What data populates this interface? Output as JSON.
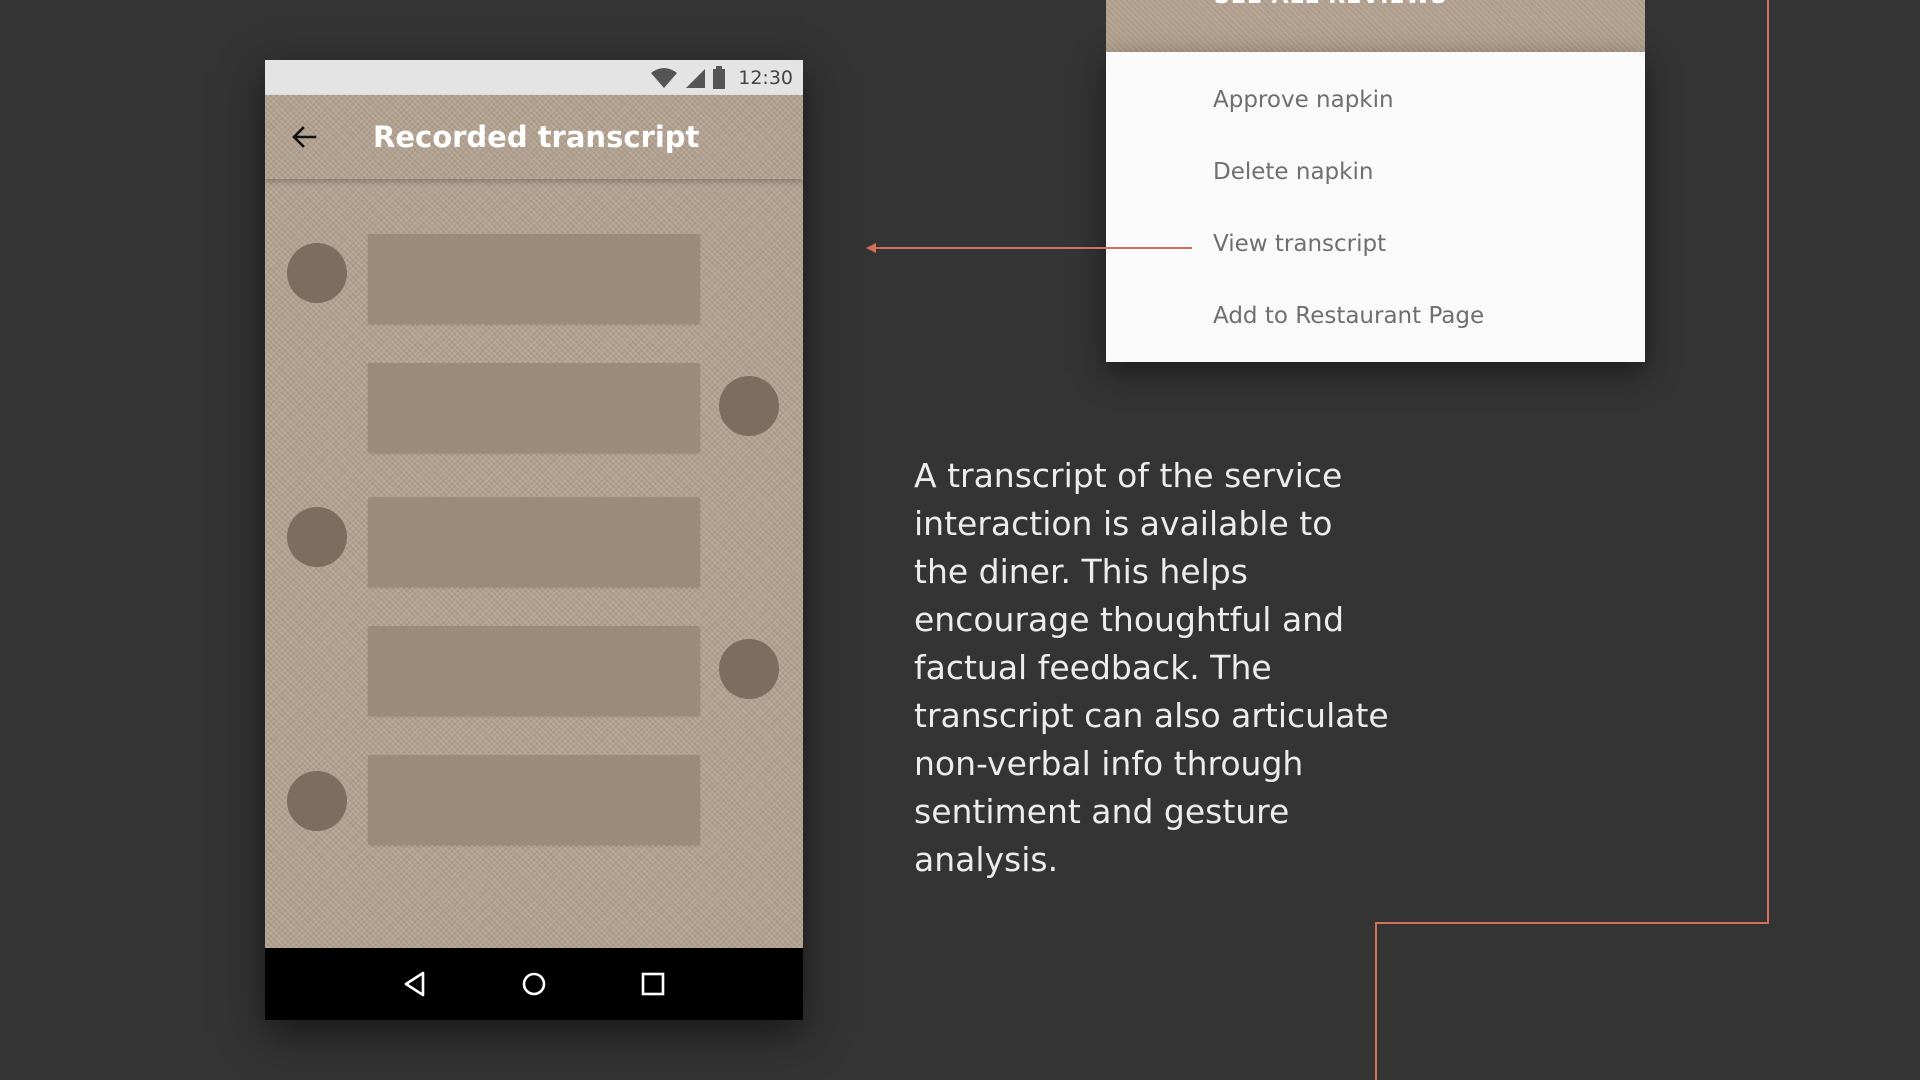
{
  "phone": {
    "status_bar": {
      "time": "12:30",
      "icons": [
        "wifi-icon",
        "cell-signal-icon",
        "battery-icon"
      ]
    },
    "app_bar": {
      "back_icon": "back-arrow-icon",
      "title": "Recorded transcript"
    },
    "transcript_messages": [
      {
        "speaker_side": "left"
      },
      {
        "speaker_side": "right"
      },
      {
        "speaker_side": "left"
      },
      {
        "speaker_side": "right"
      },
      {
        "speaker_side": "left"
      }
    ],
    "nav_bar": {
      "buttons": [
        "nav-back-icon",
        "nav-home-icon",
        "nav-recents-icon"
      ]
    }
  },
  "menu": {
    "header_text": "SEE ALL REVIEWS",
    "items": [
      {
        "label": "Approve napkin"
      },
      {
        "label": "Delete napkin"
      },
      {
        "label": "View transcript"
      },
      {
        "label": "Add to Restaurant Page"
      }
    ]
  },
  "description": "A transcript of the service interaction is available to the diner. This helps encourage thoughtful and factual feedback. The transcript can also articulate non-verbal info through sentiment and gesture analysis.",
  "colors": {
    "background": "#343434",
    "accent_line": "#d3705c",
    "texture": "#b4a291",
    "bubble": "#9c8a7b",
    "avatar": "#7e6c5f"
  }
}
